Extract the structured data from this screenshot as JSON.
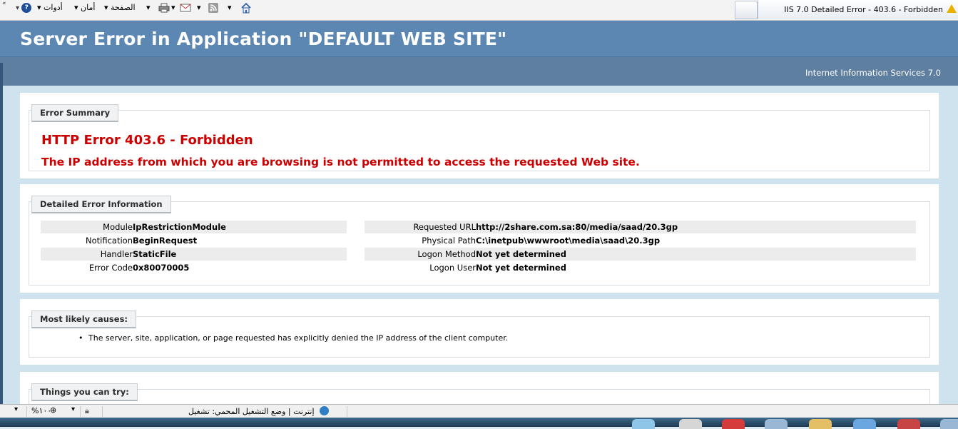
{
  "browser": {
    "tab_title": "IIS 7.0 Detailed Error - 403.6 - Forbidden",
    "menu": {
      "tools": "أدوات",
      "safety": "أمان",
      "page": "الصفحة"
    }
  },
  "page": {
    "title": "Server Error in Application \"DEFAULT WEB SITE\"",
    "subtitle": "Internet Information Services 7.0"
  },
  "error_summary": {
    "legend": "Error Summary",
    "title": "HTTP Error 403.6 - Forbidden",
    "message": "The IP address from which you are browsing is not permitted to access the requested Web site."
  },
  "detailed": {
    "legend": "Detailed Error Information",
    "left": [
      {
        "label": "Module",
        "value": "IpRestrictionModule"
      },
      {
        "label": "Notification",
        "value": "BeginRequest"
      },
      {
        "label": "Handler",
        "value": "StaticFile"
      },
      {
        "label": "Error Code",
        "value": "0x80070005"
      }
    ],
    "right": [
      {
        "label": "Requested URL",
        "value": "http://2share.com.sa:80/media/saad/20.3gp"
      },
      {
        "label": "Physical Path",
        "value": "C:\\inetpub\\wwwroot\\media\\saad\\20.3gp"
      },
      {
        "label": "Logon Method",
        "value": "Not yet determined"
      },
      {
        "label": "Logon User",
        "value": "Not yet determined"
      }
    ]
  },
  "causes": {
    "legend": "Most likely causes:",
    "items": [
      "The server, site, application, or page requested has explicitly denied the IP address of the client computer."
    ]
  },
  "things": {
    "legend": "Things you can try:"
  },
  "status": {
    "zone": "إنترنت | وضع التشغيل المحمي: تشغيل",
    "zoom": "%١٠٠"
  }
}
